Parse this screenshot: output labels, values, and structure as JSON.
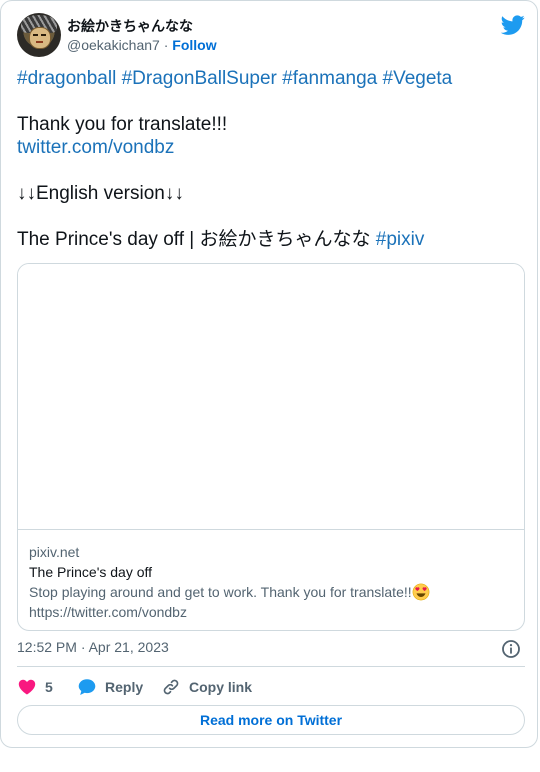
{
  "tweet": {
    "author_name": "お絵かきちゃんなな",
    "handle": "@oekakichan7",
    "separator": "·",
    "follow_label": "Follow",
    "hashtags": [
      "#dragonball",
      "#DragonBallSuper",
      "#fanmanga",
      "#Vegeta"
    ],
    "line_thanks": "Thank you for translate!!!",
    "link_text": "twitter.com/vondbz",
    "line_english": "↓↓English version↓↓",
    "line_title_prefix": "The Prince's day off | お絵かきちゃんなな",
    "line_title_tag": "#pixiv",
    "timestamp": "12:52 PM · Apr 21, 2023"
  },
  "link_card": {
    "domain": "pixiv.net",
    "title": "The Prince's day off",
    "description": "Stop playing around and get to work. Thank you for translate!!",
    "url": "https://twitter.com/vondbz"
  },
  "actions": {
    "like_count": "5",
    "reply_label": "Reply",
    "copy_label": "Copy link"
  },
  "footer": {
    "read_more_label": "Read more on Twitter"
  },
  "colors": {
    "accent": "#1d9bf0",
    "link": "#1b72b9",
    "heart": "#f91880",
    "muted": "#536471",
    "border": "#cfd9de"
  }
}
